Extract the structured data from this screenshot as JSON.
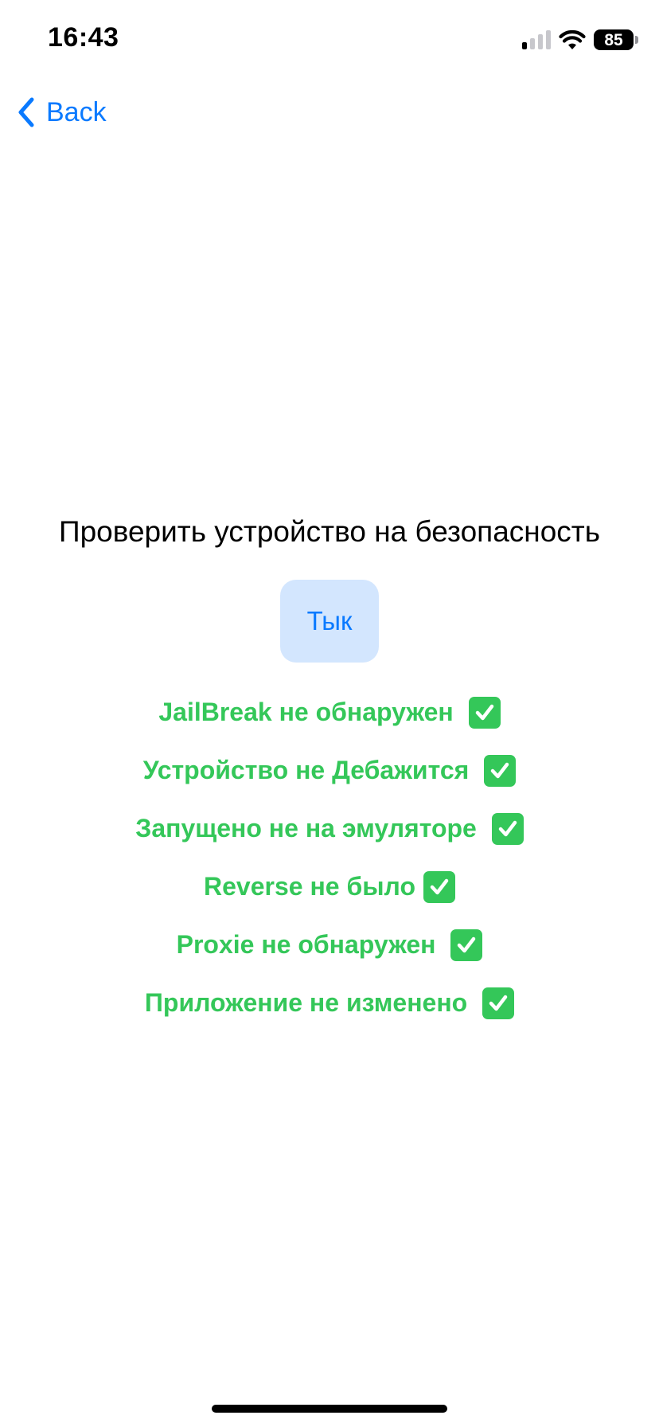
{
  "status_bar": {
    "time": "16:43",
    "battery_level": "85",
    "icons": [
      "cellular-signal-icon",
      "wifi-icon",
      "battery-icon"
    ]
  },
  "nav": {
    "back_label": "Back",
    "back_icon": "chevron-left-icon"
  },
  "main": {
    "title": "Проверить устройство на безопасность",
    "button_label": "Тык",
    "checks": [
      {
        "text": "JailBreak не обнаружен ",
        "icon": "check-mark-icon"
      },
      {
        "text": "Устройство не Дебажится ",
        "icon": "check-mark-icon"
      },
      {
        "text": "Запущено не на эмуляторе ",
        "icon": "check-mark-icon"
      },
      {
        "text": "Reverse не было",
        "icon": "check-mark-icon"
      },
      {
        "text": "Proxie не обнаружен ",
        "icon": "check-mark-icon"
      },
      {
        "text": "Приложение не изменено ",
        "icon": "check-mark-icon"
      }
    ]
  },
  "colors": {
    "accent": "#0a7aff",
    "button_background": "#d3e6fe",
    "success": "#34c759",
    "text": "#000000",
    "background": "#ffffff"
  }
}
